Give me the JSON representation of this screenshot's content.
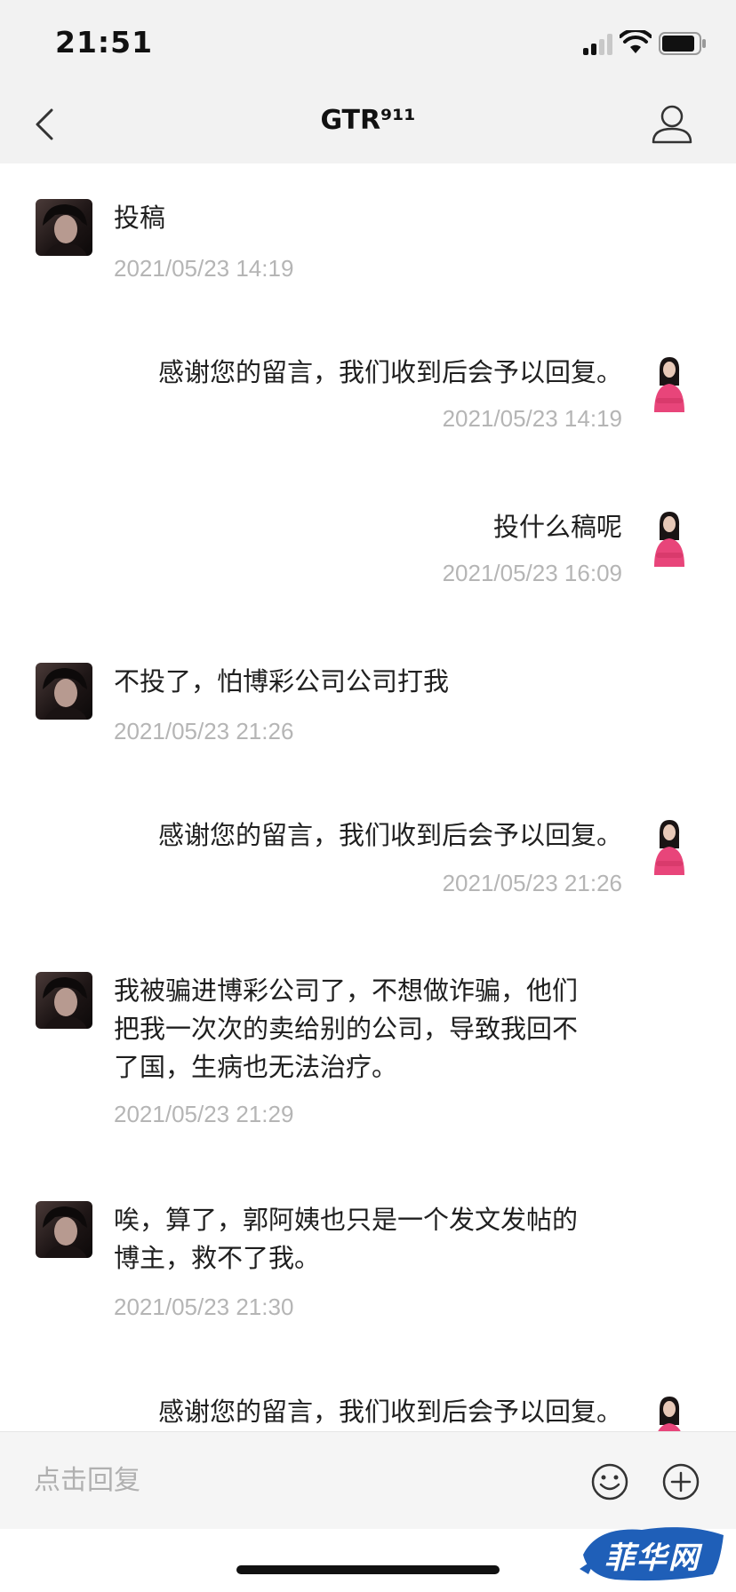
{
  "status_bar": {
    "time": "21:51"
  },
  "nav": {
    "title": "GTR⁹¹¹"
  },
  "messages": [
    {
      "side": "left",
      "lines": [
        "投稿"
      ],
      "time": "2021/05/23 14:19"
    },
    {
      "side": "right",
      "lines": [
        "感谢您的留言，我们收到后会予以回复。"
      ],
      "time": "2021/05/23 14:19"
    },
    {
      "side": "right",
      "lines": [
        "投什么稿呢"
      ],
      "time": "2021/05/23 16:09"
    },
    {
      "side": "left",
      "lines": [
        "不投了，怕博彩公司公司打我"
      ],
      "time": "2021/05/23 21:26"
    },
    {
      "side": "right",
      "lines": [
        "感谢您的留言，我们收到后会予以回复。"
      ],
      "time": "2021/05/23 21:26"
    },
    {
      "side": "left",
      "lines": [
        "我被骗进博彩公司了，不想做诈骗，他们",
        "把我一次次的卖给别的公司，导致我回不",
        "了国，生病也无法治疗。"
      ],
      "time": "2021/05/23 21:29"
    },
    {
      "side": "left",
      "lines": [
        "唉，算了，郭阿姨也只是一个发文发帖的",
        "博主，救不了我。"
      ],
      "time": "2021/05/23 21:30"
    },
    {
      "side": "right",
      "lines": [
        "感谢您的留言，我们收到后会予以回复。"
      ],
      "time": ""
    }
  ],
  "reply": {
    "placeholder": "点击回复"
  },
  "watermark": {
    "text": "菲华网"
  },
  "colors": {
    "accent_pink": "#e8457a",
    "watermark_blue": "#1f5fb8",
    "timestamp_gray": "#b5b5b5"
  }
}
